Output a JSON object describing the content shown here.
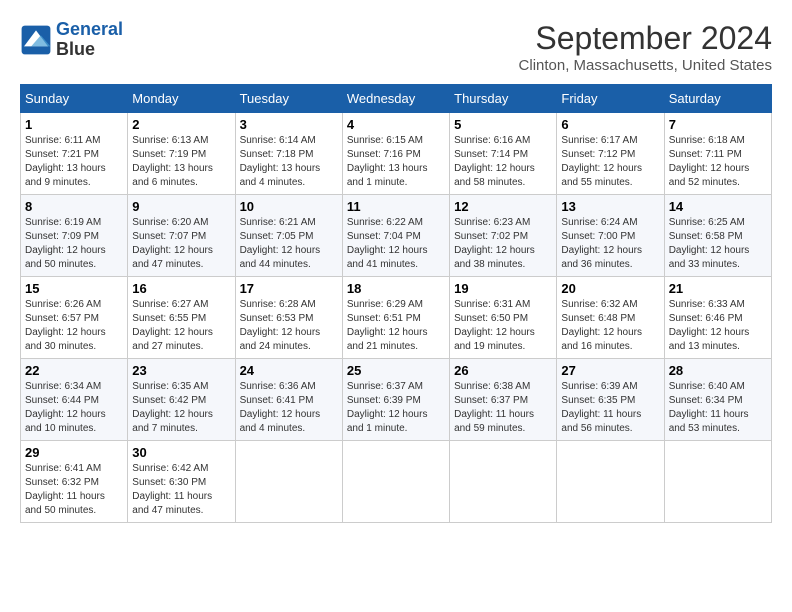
{
  "header": {
    "logo_line1": "General",
    "logo_line2": "Blue",
    "month": "September 2024",
    "location": "Clinton, Massachusetts, United States"
  },
  "weekdays": [
    "Sunday",
    "Monday",
    "Tuesday",
    "Wednesday",
    "Thursday",
    "Friday",
    "Saturday"
  ],
  "weeks": [
    [
      {
        "day": "1",
        "sunrise": "6:11 AM",
        "sunset": "7:21 PM",
        "daylight": "13 hours and 9 minutes."
      },
      {
        "day": "2",
        "sunrise": "6:13 AM",
        "sunset": "7:19 PM",
        "daylight": "13 hours and 6 minutes."
      },
      {
        "day": "3",
        "sunrise": "6:14 AM",
        "sunset": "7:18 PM",
        "daylight": "13 hours and 4 minutes."
      },
      {
        "day": "4",
        "sunrise": "6:15 AM",
        "sunset": "7:16 PM",
        "daylight": "13 hours and 1 minute."
      },
      {
        "day": "5",
        "sunrise": "6:16 AM",
        "sunset": "7:14 PM",
        "daylight": "12 hours and 58 minutes."
      },
      {
        "day": "6",
        "sunrise": "6:17 AM",
        "sunset": "7:12 PM",
        "daylight": "12 hours and 55 minutes."
      },
      {
        "day": "7",
        "sunrise": "6:18 AM",
        "sunset": "7:11 PM",
        "daylight": "12 hours and 52 minutes."
      }
    ],
    [
      {
        "day": "8",
        "sunrise": "6:19 AM",
        "sunset": "7:09 PM",
        "daylight": "12 hours and 50 minutes."
      },
      {
        "day": "9",
        "sunrise": "6:20 AM",
        "sunset": "7:07 PM",
        "daylight": "12 hours and 47 minutes."
      },
      {
        "day": "10",
        "sunrise": "6:21 AM",
        "sunset": "7:05 PM",
        "daylight": "12 hours and 44 minutes."
      },
      {
        "day": "11",
        "sunrise": "6:22 AM",
        "sunset": "7:04 PM",
        "daylight": "12 hours and 41 minutes."
      },
      {
        "day": "12",
        "sunrise": "6:23 AM",
        "sunset": "7:02 PM",
        "daylight": "12 hours and 38 minutes."
      },
      {
        "day": "13",
        "sunrise": "6:24 AM",
        "sunset": "7:00 PM",
        "daylight": "12 hours and 36 minutes."
      },
      {
        "day": "14",
        "sunrise": "6:25 AM",
        "sunset": "6:58 PM",
        "daylight": "12 hours and 33 minutes."
      }
    ],
    [
      {
        "day": "15",
        "sunrise": "6:26 AM",
        "sunset": "6:57 PM",
        "daylight": "12 hours and 30 minutes."
      },
      {
        "day": "16",
        "sunrise": "6:27 AM",
        "sunset": "6:55 PM",
        "daylight": "12 hours and 27 minutes."
      },
      {
        "day": "17",
        "sunrise": "6:28 AM",
        "sunset": "6:53 PM",
        "daylight": "12 hours and 24 minutes."
      },
      {
        "day": "18",
        "sunrise": "6:29 AM",
        "sunset": "6:51 PM",
        "daylight": "12 hours and 21 minutes."
      },
      {
        "day": "19",
        "sunrise": "6:31 AM",
        "sunset": "6:50 PM",
        "daylight": "12 hours and 19 minutes."
      },
      {
        "day": "20",
        "sunrise": "6:32 AM",
        "sunset": "6:48 PM",
        "daylight": "12 hours and 16 minutes."
      },
      {
        "day": "21",
        "sunrise": "6:33 AM",
        "sunset": "6:46 PM",
        "daylight": "12 hours and 13 minutes."
      }
    ],
    [
      {
        "day": "22",
        "sunrise": "6:34 AM",
        "sunset": "6:44 PM",
        "daylight": "12 hours and 10 minutes."
      },
      {
        "day": "23",
        "sunrise": "6:35 AM",
        "sunset": "6:42 PM",
        "daylight": "12 hours and 7 minutes."
      },
      {
        "day": "24",
        "sunrise": "6:36 AM",
        "sunset": "6:41 PM",
        "daylight": "12 hours and 4 minutes."
      },
      {
        "day": "25",
        "sunrise": "6:37 AM",
        "sunset": "6:39 PM",
        "daylight": "12 hours and 1 minute."
      },
      {
        "day": "26",
        "sunrise": "6:38 AM",
        "sunset": "6:37 PM",
        "daylight": "11 hours and 59 minutes."
      },
      {
        "day": "27",
        "sunrise": "6:39 AM",
        "sunset": "6:35 PM",
        "daylight": "11 hours and 56 minutes."
      },
      {
        "day": "28",
        "sunrise": "6:40 AM",
        "sunset": "6:34 PM",
        "daylight": "11 hours and 53 minutes."
      }
    ],
    [
      {
        "day": "29",
        "sunrise": "6:41 AM",
        "sunset": "6:32 PM",
        "daylight": "11 hours and 50 minutes."
      },
      {
        "day": "30",
        "sunrise": "6:42 AM",
        "sunset": "6:30 PM",
        "daylight": "11 hours and 47 minutes."
      },
      null,
      null,
      null,
      null,
      null
    ]
  ]
}
